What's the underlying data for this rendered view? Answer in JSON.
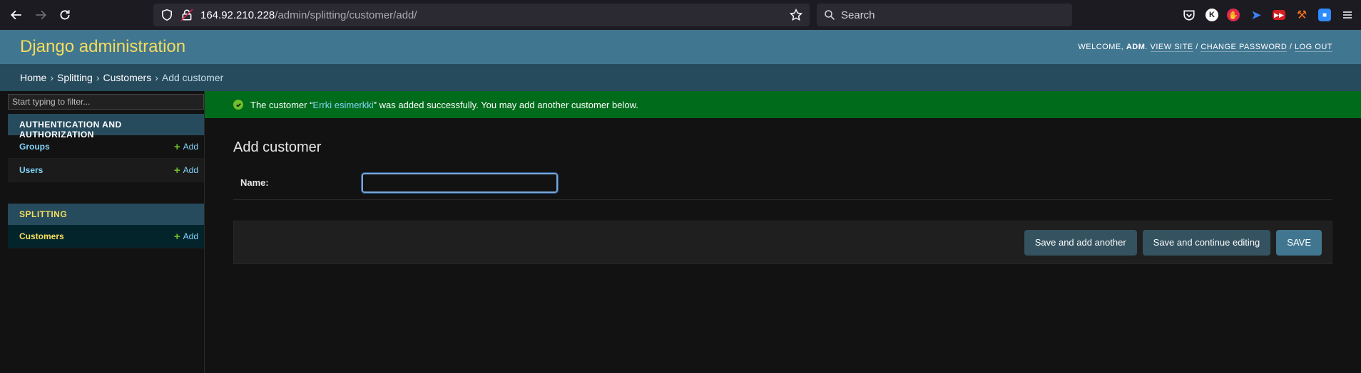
{
  "browser": {
    "url_host": "164.92.210.228",
    "url_path": "/admin/splitting/customer/add/",
    "search_placeholder": "Search"
  },
  "header": {
    "branding": "Django administration",
    "welcome": "WELCOME,",
    "username": "ADM",
    "view_site": "VIEW SITE",
    "change_password": "CHANGE PASSWORD",
    "log_out": "LOG OUT"
  },
  "breadcrumbs": {
    "home": "Home",
    "app": "Splitting",
    "model": "Customers",
    "current": "Add customer",
    "separator": "›"
  },
  "sidebar": {
    "filter_placeholder": "Start typing to filter...",
    "modules": [
      {
        "caption": "AUTHENTICATION AND AUTHORIZATION",
        "models": [
          {
            "label": "Groups",
            "add": "Add"
          },
          {
            "label": "Users",
            "add": "Add"
          }
        ]
      },
      {
        "caption": "SPLITTING",
        "models": [
          {
            "label": "Customers",
            "add": "Add"
          }
        ]
      }
    ]
  },
  "message": {
    "prefix": "The customer “",
    "object_name": "Errki esimerkki",
    "suffix": "” was added successfully. You may add another customer below."
  },
  "content": {
    "title": "Add customer",
    "name_label": "Name:",
    "name_value": ""
  },
  "submit": {
    "save_add_another": "Save and add another",
    "save_continue": "Save and continue editing",
    "save": "SAVE"
  },
  "colors": {
    "header_bg": "#417690",
    "breadcrumbs_bg": "#264b5d",
    "branding": "#f5dd5d",
    "success_bg": "#006b1b",
    "link": "#81d4fa",
    "add_plus": "#70bf2b"
  }
}
